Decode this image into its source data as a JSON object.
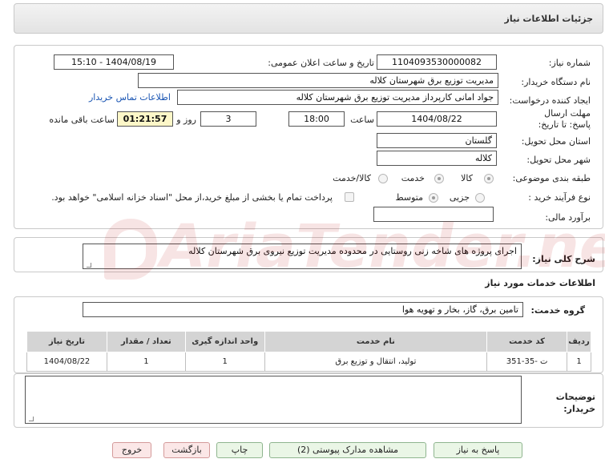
{
  "title": "جزئیات اطلاعات نیاز",
  "fields": {
    "need_number_label": "شماره نیاز:",
    "need_number": "1104093530000082",
    "announce_label": "تاریخ و ساعت اعلان عمومی:",
    "announce_value": "1404/08/19 - 15:10",
    "buyer_org_label": "نام دستگاه خریدار:",
    "buyer_org": "مدیریت توزیع برق شهرستان کلاله",
    "requester_label": "ایجاد کننده درخواست:",
    "requester": "جواد امانی کارپرداز مدیریت توزیع برق شهرستان کلاله",
    "contact_link": "اطلاعات تماس خریدار",
    "deadline_label": "مهلت ارسال پاسخ: تا تاریخ:",
    "deadline_date": "1404/08/22",
    "time_label": "ساعت",
    "deadline_time": "18:00",
    "days_value": "3",
    "days_label": "روز و",
    "remaining_time": "01:21:57",
    "remaining_label": "ساعت باقی مانده",
    "province_label": "استان محل تحویل:",
    "province": "گلستان",
    "city_label": "شهر محل تحویل:",
    "city": "کلاله",
    "category_label": "طبقه بندی موضوعی:",
    "category_options": [
      "کالا",
      "خدمت",
      "کالا/خدمت"
    ],
    "purchase_type_label": "نوع فرآیند خرید :",
    "purchase_options": [
      "جزیی",
      "متوسط"
    ],
    "payment_note": "پرداخت تمام یا بخشی از مبلغ خرید،از محل \"اسناد خزانه اسلامی\" خواهد بود.",
    "estimate_label": "برآورد مالی:",
    "estimate_value": ""
  },
  "description": {
    "label": "شرح کلی نیاز:",
    "value": "اجرای پروژه های شاخه زنی روستایی در محدوده مدیریت توزیع نیروی برق شهرستان کلاله"
  },
  "services": {
    "section_title": "اطلاعات خدمات مورد نیاز",
    "group_label": "گروه خدمت:",
    "group_value": "تامین برق، گاز، بخار و تهویه هوا",
    "table": {
      "headers": [
        "ردیف",
        "کد خدمت",
        "نام خدمت",
        "واحد اندازه گیری",
        "تعداد / مقدار",
        "تاریخ نیاز"
      ],
      "rows": [
        [
          "1",
          "ت -35-351",
          "تولید، انتقال و توزیع برق",
          "1",
          "1",
          "1404/08/22"
        ]
      ]
    }
  },
  "buyer_notes": {
    "label": "توضیحات خریدار:",
    "value": ""
  },
  "buttons": {
    "reply": "پاسخ به نیاز",
    "attachments": "مشاهده مدارک پیوستی (2)",
    "print": "چاپ",
    "back": "بازگشت",
    "exit": "خروج"
  },
  "watermark": "AriaTender.net",
  "colors": {
    "link": "#1a55b3",
    "remaining_bg": "#fdf7c8",
    "button_green": "#eaf6e6",
    "button_red": "#fbe7e7"
  }
}
